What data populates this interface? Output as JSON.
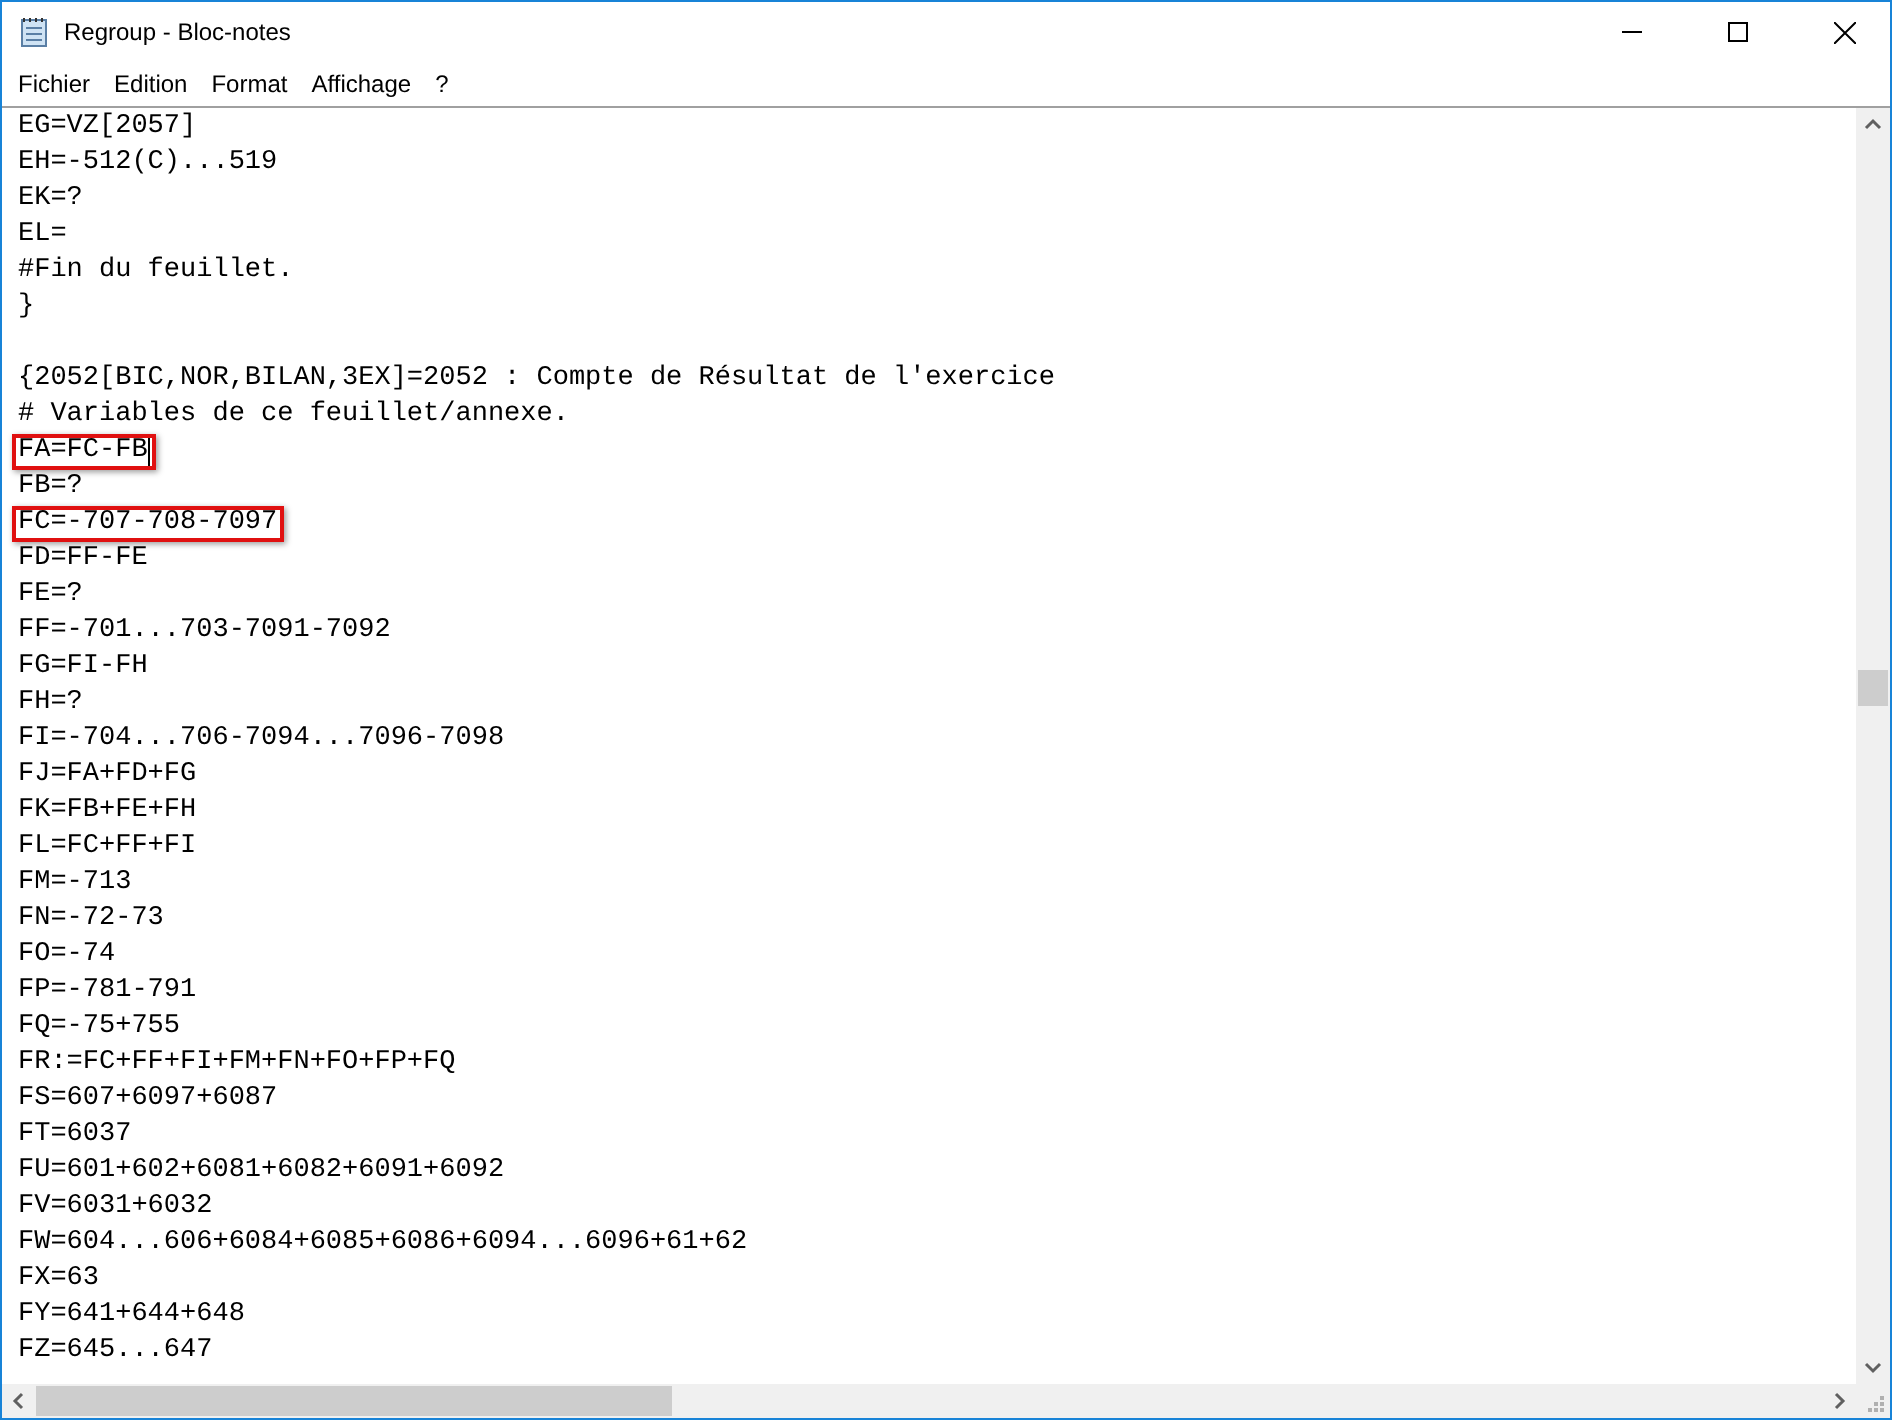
{
  "window": {
    "title": "Regroup - Bloc-notes"
  },
  "menu": [
    "Fichier",
    "Edition",
    "Format",
    "Affichage",
    "?"
  ],
  "lines": [
    {
      "text": "EG=VZ[2057]",
      "highlighted": false,
      "caret": false
    },
    {
      "text": "EH=-512(C)...519",
      "highlighted": false,
      "caret": false
    },
    {
      "text": "EK=?",
      "highlighted": false,
      "caret": false
    },
    {
      "text": "EL=",
      "highlighted": false,
      "caret": false
    },
    {
      "text": "#Fin du feuillet.",
      "highlighted": false,
      "caret": false
    },
    {
      "text": "}",
      "highlighted": false,
      "caret": false
    },
    {
      "blank_line_before": true,
      "text": "{2052[BIC,NOR,BILAN,3EX]=2052 : Compte de Résultat de l'exercice",
      "highlighted": false,
      "caret": false
    },
    {
      "text": "# Variables de ce feuillet/annexe.",
      "highlighted": false,
      "caret": false
    },
    {
      "text": "FA=FC-FB",
      "highlighted": true,
      "caret": true
    },
    {
      "text": "FB=?",
      "highlighted": false,
      "caret": false
    },
    {
      "text": "FC=-707-708-7097",
      "highlighted": true,
      "caret": false
    },
    {
      "text": "FD=FF-FE",
      "highlighted": false,
      "caret": false
    },
    {
      "text": "FE=?",
      "highlighted": false,
      "caret": false
    },
    {
      "text": "FF=-701...703-7091-7092",
      "highlighted": false,
      "caret": false
    },
    {
      "text": "FG=FI-FH",
      "highlighted": false,
      "caret": false
    },
    {
      "text": "FH=?",
      "highlighted": false,
      "caret": false
    },
    {
      "text": "FI=-704...706-7094...7096-7098",
      "highlighted": false,
      "caret": false
    },
    {
      "text": "FJ=FA+FD+FG",
      "highlighted": false,
      "caret": false
    },
    {
      "text": "FK=FB+FE+FH",
      "highlighted": false,
      "caret": false
    },
    {
      "text": "FL=FC+FF+FI",
      "highlighted": false,
      "caret": false
    },
    {
      "text": "FM=-713",
      "highlighted": false,
      "caret": false
    },
    {
      "text": "FN=-72-73",
      "highlighted": false,
      "caret": false
    },
    {
      "text": "FO=-74",
      "highlighted": false,
      "caret": false
    },
    {
      "text": "FP=-781-791",
      "highlighted": false,
      "caret": false
    },
    {
      "text": "FQ=-75+755",
      "highlighted": false,
      "caret": false
    },
    {
      "text": "FR:=FC+FF+FI+FM+FN+FO+FP+FQ",
      "highlighted": false,
      "caret": false
    },
    {
      "text": "FS=607+6097+6087",
      "highlighted": false,
      "caret": false
    },
    {
      "text": "FT=6037",
      "highlighted": false,
      "caret": false
    },
    {
      "text": "FU=601+602+6081+6082+6091+6092",
      "highlighted": false,
      "caret": false
    },
    {
      "text": "FV=6031+6032",
      "highlighted": false,
      "caret": false
    },
    {
      "text": "FW=604...606+6084+6085+6086+6094...6096+61+62",
      "highlighted": false,
      "caret": false
    },
    {
      "text": "FX=63",
      "highlighted": false,
      "caret": false
    },
    {
      "text": "FY=641+644+648",
      "highlighted": false,
      "caret": false
    },
    {
      "text": "FZ=645...647",
      "highlighted": false,
      "caret": false
    }
  ]
}
